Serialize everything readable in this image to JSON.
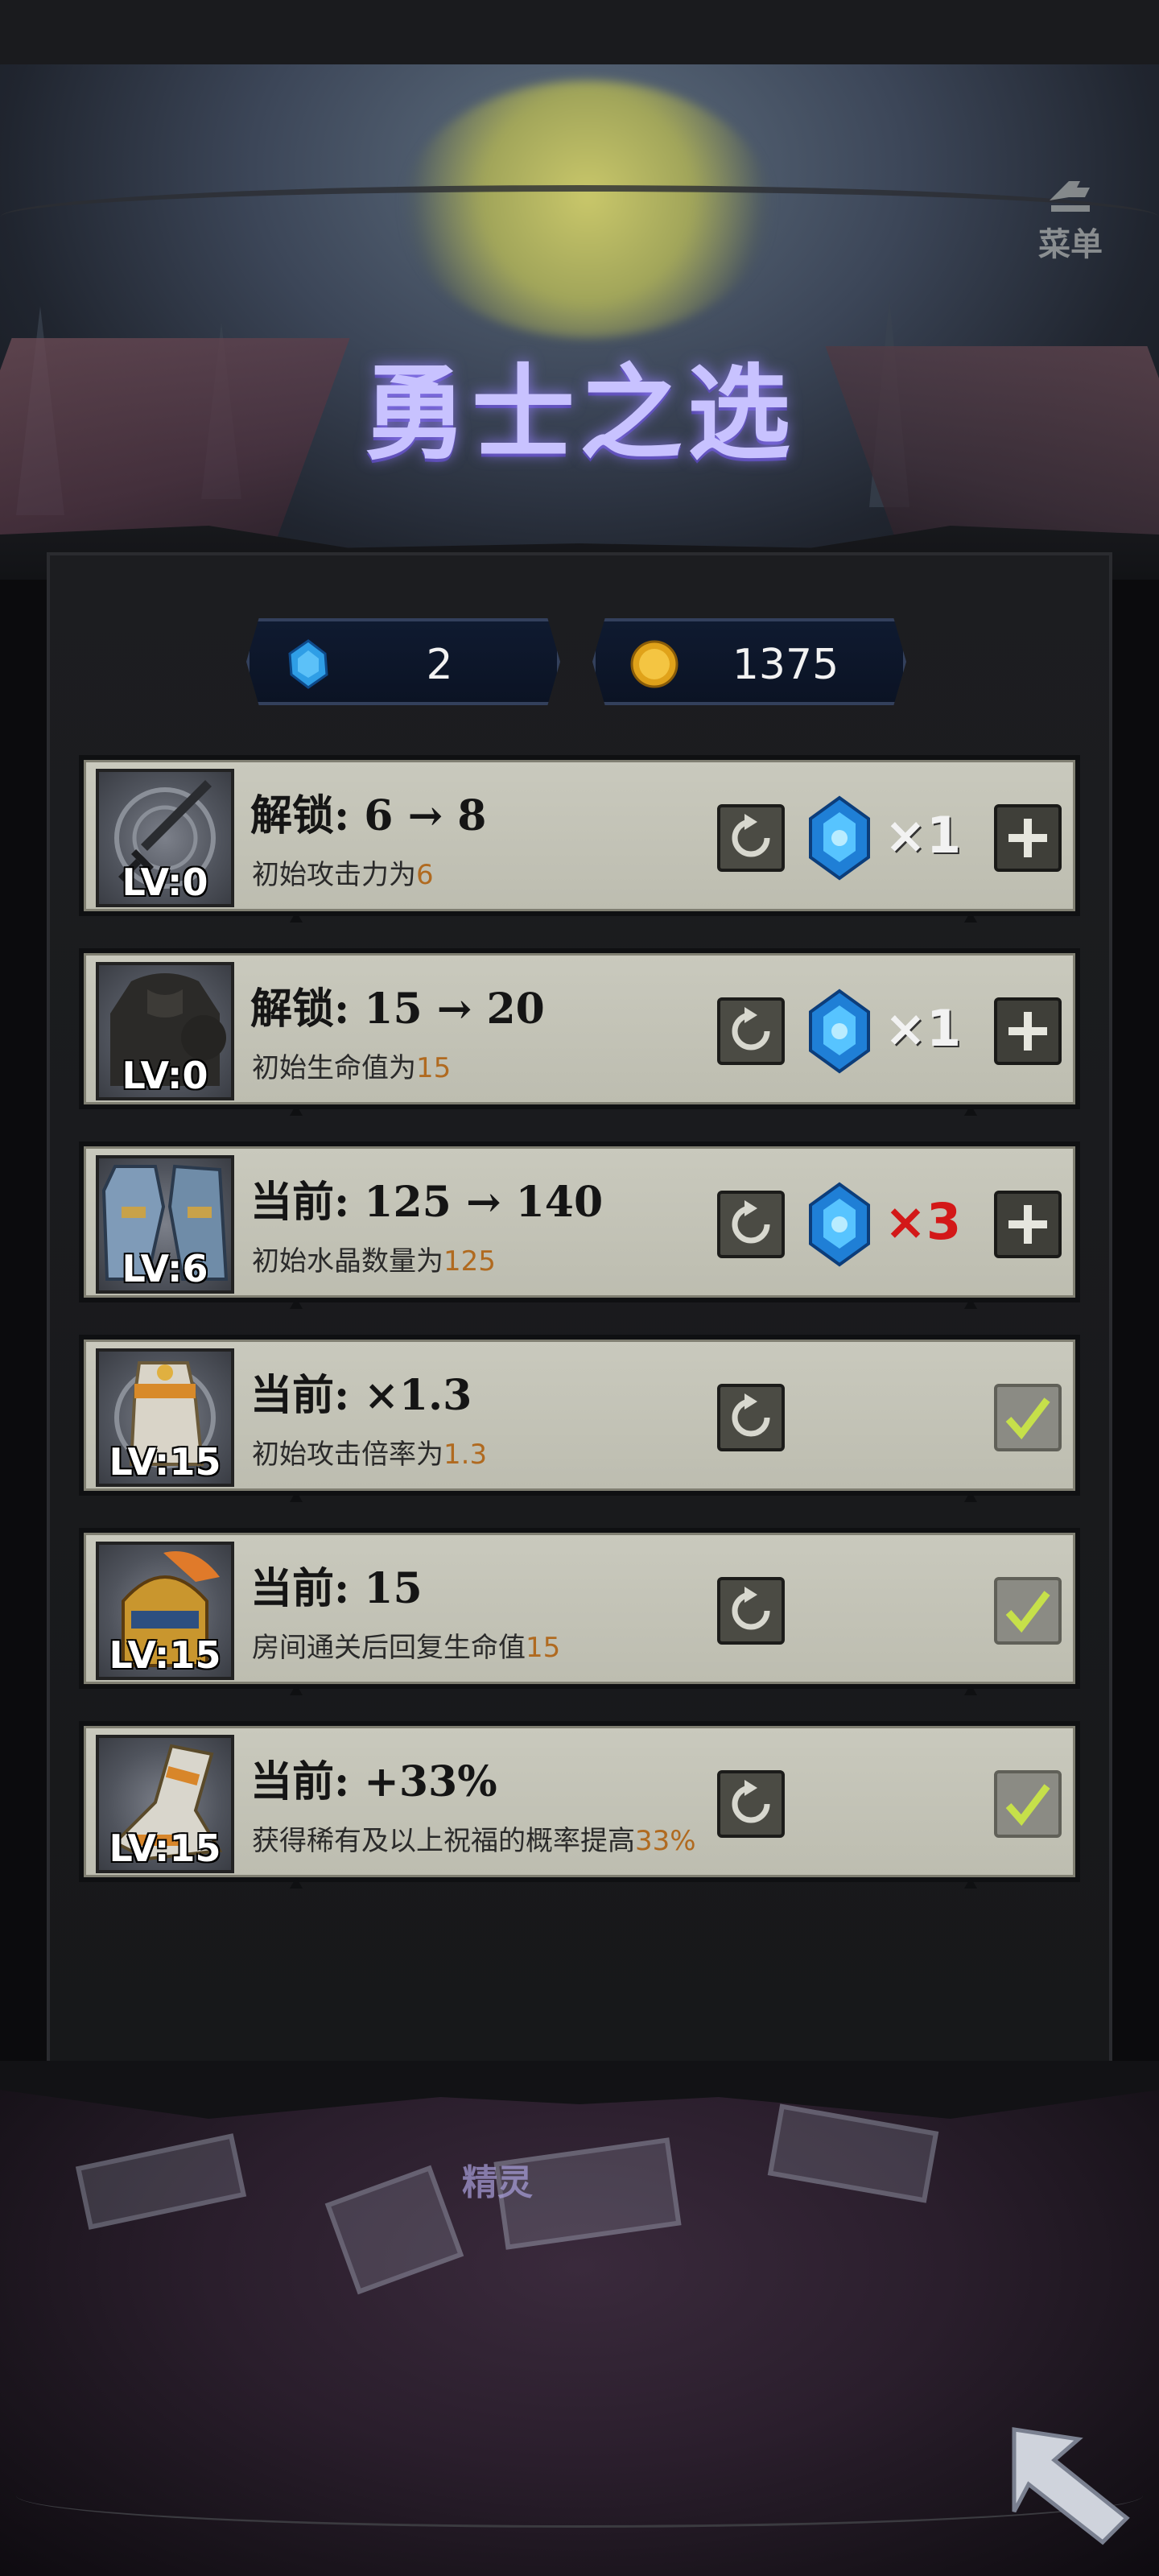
{
  "header": {
    "title": "勇士之选",
    "menu_label": "菜单"
  },
  "currency": {
    "crystals": "2",
    "gold": "1375"
  },
  "upgrades": [
    {
      "level": "LV:0",
      "title": "解锁: 6 → 8",
      "desc_prefix": "初始攻击力为",
      "desc_value": "6",
      "multiplier": "×1",
      "multiplier_color": "white",
      "state": "buy",
      "portrait": "sword-icon"
    },
    {
      "level": "LV:0",
      "title": "解锁: 15 → 20",
      "desc_prefix": "初始生命值为",
      "desc_value": "15",
      "multiplier": "×1",
      "multiplier_color": "white",
      "state": "buy",
      "portrait": "armor-icon"
    },
    {
      "level": "LV:6",
      "title": "当前: 125 → 140",
      "desc_prefix": "初始水晶数量为",
      "desc_value": "125",
      "multiplier": "×3",
      "multiplier_color": "#d31818",
      "state": "buy",
      "portrait": "shoulder-armor-icon"
    },
    {
      "level": "LV:15",
      "title": "当前: ×1.3",
      "desc_prefix": "初始攻击倍率为",
      "desc_value": "1.3",
      "state": "maxed",
      "portrait": "gauntlet-icon"
    },
    {
      "level": "LV:15",
      "title": "当前: 15",
      "desc_prefix": "房间通关后回复生命值",
      "desc_value": "15",
      "state": "maxed",
      "portrait": "helmet-icon"
    },
    {
      "level": "LV:15",
      "title": "当前: +33%",
      "desc_prefix": "获得稀有及以上祝福的概率提高",
      "desc_value": "33%",
      "state": "maxed",
      "portrait": "greaves-icon"
    }
  ],
  "footer": {
    "sprite_label": "精灵"
  },
  "colors": {
    "title_glow": "#c8c2ff",
    "highlight": "#b06a20",
    "row_bg": "#c9c9bd",
    "crystal": "#2f9ee6",
    "gold": "#e0a21a"
  }
}
